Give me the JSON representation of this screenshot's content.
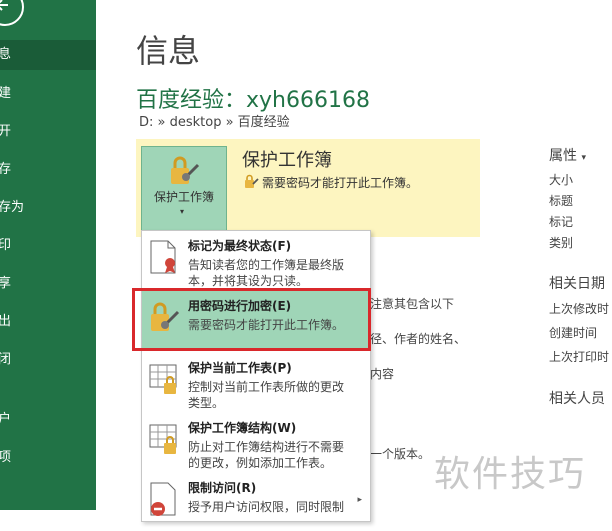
{
  "sidebar": {
    "items": [
      {
        "label": "息",
        "active": true
      },
      {
        "label": "建"
      },
      {
        "label": "开"
      },
      {
        "label": "存"
      },
      {
        "label": "存为"
      },
      {
        "label": "印"
      },
      {
        "label": "享"
      },
      {
        "label": "出"
      },
      {
        "label": "闭"
      },
      {
        "label": "户"
      },
      {
        "label": "项"
      }
    ]
  },
  "main": {
    "page_title": "信息",
    "doc_title": "百度经验：xyh666168",
    "doc_path": "D: » desktop » 百度经验",
    "protect": {
      "button_label": "保护工作簿",
      "button_arrow": "▾",
      "heading": "保护工作簿",
      "description": "需要密码才能打开此工作簿。"
    },
    "background_text": {
      "line1": "注意其包含以下",
      "line2": "径、作者的姓名、",
      "line3": "内容",
      "line4": "一个版本。"
    }
  },
  "dropdown": {
    "items": [
      {
        "title": "标记为最终状态(F)",
        "desc1": "告知读者您的工作簿是最终版",
        "desc2": "本，并将其设为只读。"
      },
      {
        "title": "用密码进行加密(E)",
        "desc1": "需要密码才能打开此工作簿。",
        "desc2": ""
      },
      {
        "title": "保护当前工作表(P)",
        "desc1": "控制对当前工作表所做的更改",
        "desc2": "类型。"
      },
      {
        "title": "保护工作簿结构(W)",
        "desc1": "防止对工作簿结构进行不需要",
        "desc2": "的更改，例如添加工作表。"
      },
      {
        "title": "限制访问(R)",
        "desc1": "授予用户访问权限，同时限制",
        "desc2": ""
      }
    ],
    "submenu_arrow": "▸"
  },
  "properties": {
    "heading": "属性",
    "heading_arrow": "▾",
    "labels": [
      "大小",
      "标题",
      "标记",
      "类别"
    ],
    "dates_heading": "相关日期",
    "dates": [
      "上次修改时",
      "创建时间",
      "上次打印时"
    ],
    "people_heading": "相关人员"
  },
  "watermark": "软件技巧",
  "colors": {
    "sidebar": "#217346",
    "highlight": "#9fd5b7",
    "protect_panel": "#fdf5c0",
    "red_box": "#d9282b"
  }
}
